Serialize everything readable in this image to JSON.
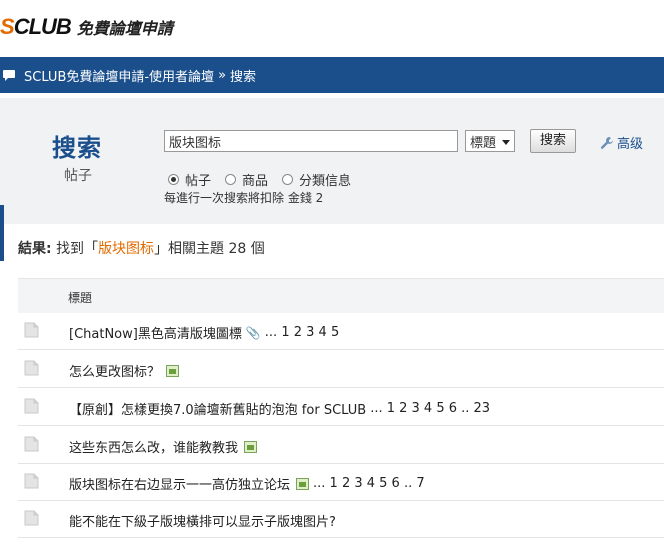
{
  "header": {
    "logo_brand_s": "S",
    "logo_brand_rest": "CLUB",
    "logo_sub": "免費論壇申請"
  },
  "nav": {
    "forum": "SCLUB免費論壇申請-使用者論壇",
    "sep": "»",
    "current": "搜索"
  },
  "search": {
    "title": "搜索",
    "subtitle": "帖子",
    "query": "版块图标",
    "field_select": "標題",
    "button": "搜索",
    "advanced": "高级",
    "types": [
      {
        "label": "帖子",
        "checked": true
      },
      {
        "label": "商品",
        "checked": false
      },
      {
        "label": "分類信息",
        "checked": false
      }
    ],
    "note": "每進行一次搜索將扣除 金錢 2"
  },
  "result": {
    "label": "結果:",
    "prefix": "找到「",
    "keyword": "版块图标",
    "suffix": "」相關主題 28 個"
  },
  "table": {
    "header": "標題",
    "rows": [
      {
        "title": "[ChatNow]黑色高清版塊圖標",
        "pages_text": "... 1 2 3 4 5"
      },
      {
        "title": "怎么更改图标？",
        "pages_text": ""
      },
      {
        "title": "【原創】怎樣更換7.0論壇新舊貼的泡泡 for SCLUB",
        "pages_text": "... 1 2 3 4 5 6 .. 23"
      },
      {
        "title": "这些东西怎么改，谁能教教我",
        "pages_text": ""
      },
      {
        "title": "版块图标在右边显示一一高仿独立论坛",
        "pages_text": "... 1 2 3 4 5 6 .. 7"
      },
      {
        "title": "能不能在下級子版塊橫排可以显示子版塊图片?",
        "pages_text": ""
      }
    ]
  }
}
